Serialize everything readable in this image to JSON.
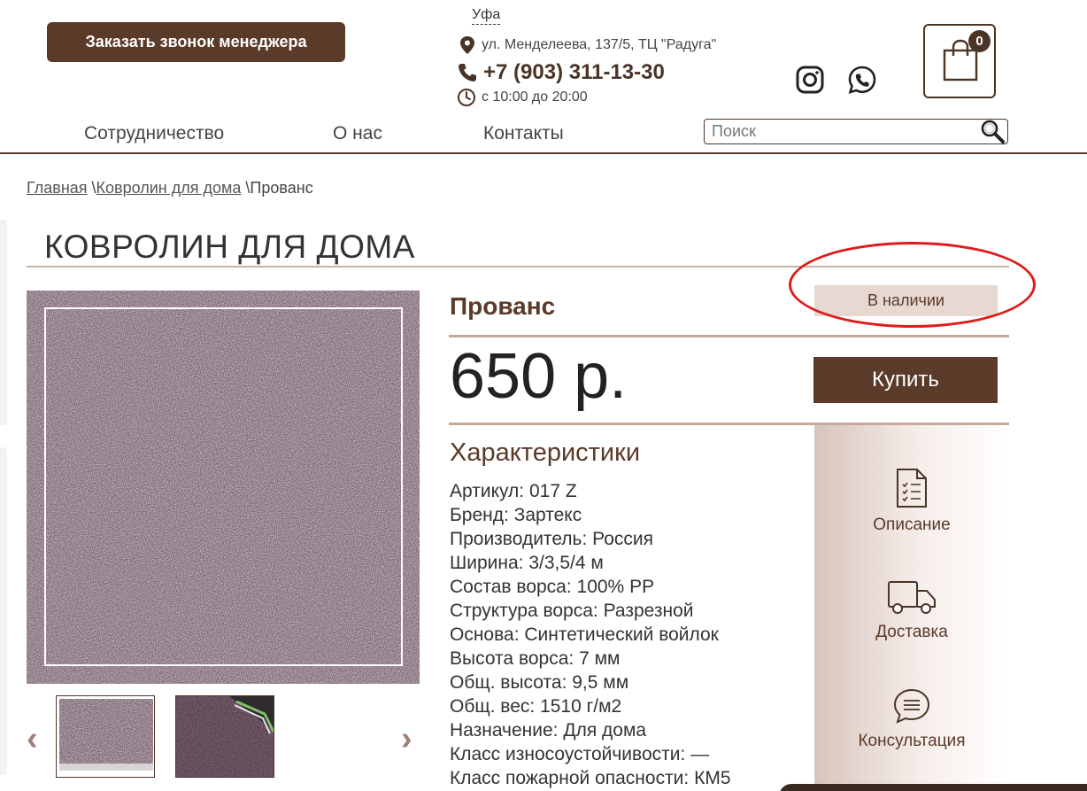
{
  "header": {
    "call_button": "Заказать звонок менеджера",
    "city": "Уфа",
    "address": "ул. Менделеева, 137/5, ТЦ \"Радуга\"",
    "phone": "+7 (903) 311-13-30",
    "hours": "с 10:00 до 20:00",
    "cart_count": "0"
  },
  "nav": {
    "items": [
      "Сотрудничество",
      "О нас",
      "Контакты"
    ]
  },
  "search": {
    "placeholder": "Поиск",
    "value": ""
  },
  "breadcrumb": {
    "home": "Главная",
    "sep1": "\\",
    "category": "Ковролин для дома",
    "sep2": "\\",
    "current": "Прованс"
  },
  "page_title": "КОВРОЛИН ДЛЯ ДОМА",
  "product": {
    "name": "Прованс",
    "stock": "В наличии",
    "price": "650 р.",
    "buy_label": "Купить",
    "characteristics_title": "Характеристики",
    "specs": [
      "Артикул: 017 Z",
      "Бренд: Зартекс",
      "Производитель: Россия",
      "Ширина: 3/3,5/4 м",
      "Состав ворса: 100% PP",
      "Структура ворса: Разрезной",
      "Основа: Синтетический войлок",
      "Высота ворса: 7 мм",
      "Общ. высота: 9,5 мм",
      "Общ. вес: 1510 г/м2",
      "Назначение: Для дома",
      "Класс износоустойчивости: —",
      "Класс пожарной опасности: КМ5"
    ]
  },
  "gallery": {
    "prev_arrow": "‹",
    "next_arrow": "›"
  },
  "side_panel": {
    "items": [
      "Описание",
      "Доставка",
      "Консультация"
    ]
  },
  "colors": {
    "brand": "#5a3a28",
    "accent_light": "#e7d8d2",
    "annotation": "#e01b1b"
  },
  "icons": [
    "map-pin-icon",
    "phone-icon",
    "clock-icon",
    "instagram-icon",
    "whatsapp-icon",
    "shopping-bag-icon",
    "search-icon",
    "document-checklist-icon",
    "truck-icon",
    "chat-bubble-icon"
  ]
}
